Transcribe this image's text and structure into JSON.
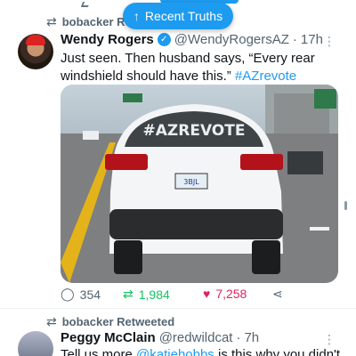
{
  "top_bar": {
    "new_tweets_label": "Recent Truths",
    "arrow": "↑"
  },
  "tweet1": {
    "retweeted_by": "bobacker Re",
    "author_name": "Wendy Rogers",
    "handle": "@WendyRogersAZ",
    "separator": "·",
    "time": "17h",
    "text_part1": "Just seen. Then husband says, “Every rear windshield should have this.” ",
    "hashtag": "#AZrevote",
    "photo_plate_text": "#AZREVOTE",
    "license_plate": "3BJL",
    "stats": {
      "replies": "354",
      "retweets": "1,984",
      "likes": "7,258"
    }
  },
  "tweet2": {
    "retweeted_by": "bobacker Retweeted",
    "author_name": "Peggy McClain",
    "handle": "@redwildcat",
    "separator": "·",
    "time": "7h",
    "text_prefix": "Tell us more ",
    "mention": "@katiehobbs",
    "text_suffix": " is this why you didn't"
  },
  "icons": [
    "retweet-icon",
    "verified-badge-icon",
    "more-options-icon",
    "reply-icon",
    "like-icon",
    "share-icon",
    "arrow-up-icon"
  ],
  "colors": {
    "accent": "#1d9bf0",
    "retweet_green": "#17bf63",
    "like_pink": "#e0245e",
    "muted_text": "#536471"
  }
}
